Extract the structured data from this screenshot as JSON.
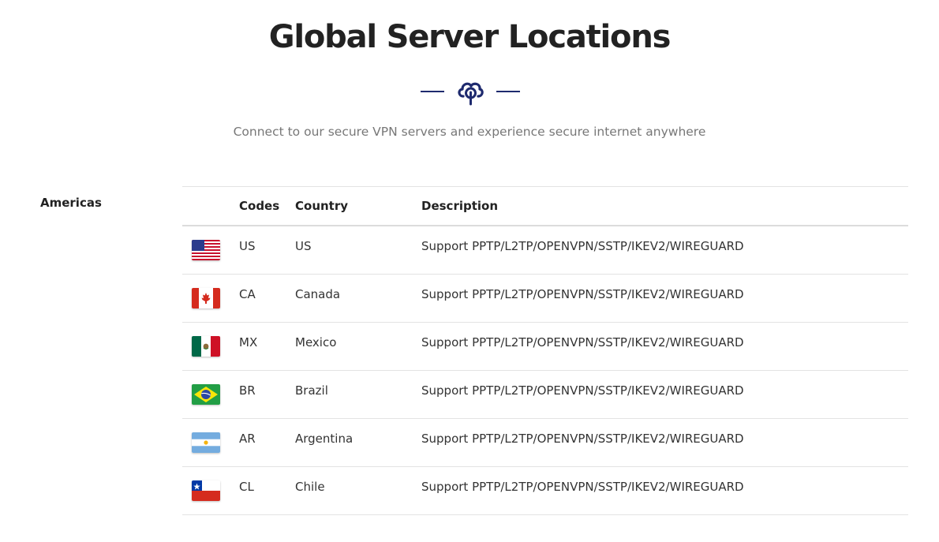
{
  "header": {
    "title": "Global Server Locations",
    "subtitle": "Connect to our secure VPN servers and experience secure internet anywhere",
    "logo_icon": "cloud-lock-icon",
    "accent_color": "#1e2a6e"
  },
  "region": {
    "label": "Americas"
  },
  "table": {
    "columns": {
      "flag": "",
      "code": "Codes",
      "country": "Country",
      "description": "Description"
    },
    "rows": [
      {
        "flag_icon": "us-flag-icon",
        "code": "US",
        "country": "US",
        "description": "Support PPTP/L2TP/OPENVPN/SSTP/IKEV2/WIREGUARD"
      },
      {
        "flag_icon": "ca-flag-icon",
        "code": "CA",
        "country": "Canada",
        "description": "Support PPTP/L2TP/OPENVPN/SSTP/IKEV2/WIREGUARD"
      },
      {
        "flag_icon": "mx-flag-icon",
        "code": "MX",
        "country": "Mexico",
        "description": "Support PPTP/L2TP/OPENVPN/SSTP/IKEV2/WIREGUARD"
      },
      {
        "flag_icon": "br-flag-icon",
        "code": "BR",
        "country": "Brazil",
        "description": "Support PPTP/L2TP/OPENVPN/SSTP/IKEV2/WIREGUARD"
      },
      {
        "flag_icon": "ar-flag-icon",
        "code": "AR",
        "country": "Argentina",
        "description": "Support PPTP/L2TP/OPENVPN/SSTP/IKEV2/WIREGUARD"
      },
      {
        "flag_icon": "cl-flag-icon",
        "code": "CL",
        "country": "Chile",
        "description": "Support PPTP/L2TP/OPENVPN/SSTP/IKEV2/WIREGUARD"
      }
    ]
  }
}
